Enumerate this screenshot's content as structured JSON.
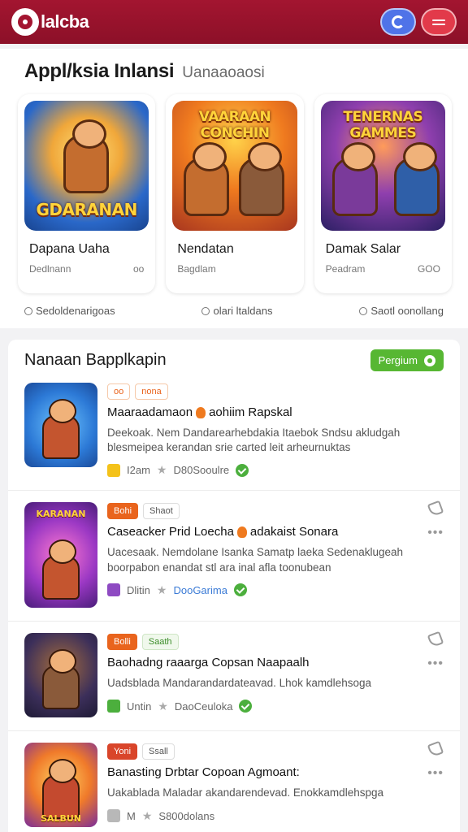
{
  "header": {
    "logo_text": "lalcba",
    "btn_profile": "profile-icon",
    "btn_menu": "menu-icon",
    "colors": {
      "bar": "#a31530",
      "profile": "#4f73e8",
      "menu": "#e23a4a"
    }
  },
  "featured": {
    "title": "Appl/ksia Inlansi",
    "subtitle": "Uanaaoaosi",
    "cards": [
      {
        "name": "Dapana Uaha",
        "meta_left": "Dedlnann",
        "meta_right": "oo",
        "banner": "GDARANAN"
      },
      {
        "name": "Nendatan",
        "meta_left": "Bagdlam",
        "meta_right": "",
        "banner": "VAARAAN CONCHIN"
      },
      {
        "name": "Damak Salar",
        "meta_left": "Peadram",
        "meta_right": "GOO",
        "banner": "TENERNAS GAMMES"
      }
    ]
  },
  "tags": [
    {
      "label": "Sedoldenarigoas"
    },
    {
      "label": "olari ltaldans"
    },
    {
      "label": "Saotl oonollang"
    }
  ],
  "listing": {
    "title": "Nanaan Bapplkapin",
    "action_label": "Pergium",
    "items": [
      {
        "chips": [
          "oo",
          "nona"
        ],
        "title": "Maaraadamaon",
        "title_suffix": "aohiim Rapskal",
        "desc": "Deekoak. Nem Dandarearhebdakia Itaebok Sndsu akludgah blesmeipea kerandan srie carted leit arheurnuktas",
        "meta_a": "I2am",
        "meta_b": "D80Sooulre",
        "banner": ""
      },
      {
        "chips": [
          "Bohi",
          "Shaot"
        ],
        "title": "Caseacker Prid Loecha",
        "title_suffix": "adakaist Sonara",
        "desc": "Uacesaak. Nemdolane Isanka Samatp laeka Sedenaklugeah boorpabon enandat stl ara inal afla toonubean",
        "meta_a": "Dlitin",
        "meta_b": "DooGarima",
        "banner": "KARANAN"
      },
      {
        "chips": [
          "Bolli",
          "Saath"
        ],
        "title": "Baohadng raaarga Copsan Naapaalh",
        "title_suffix": "",
        "desc": "Uadsblada Mandarandardateavad. Lhok kamdlehsoga",
        "meta_a": "Untin",
        "meta_b": "DaoCeuloka",
        "banner": ""
      },
      {
        "chips": [
          "Yoni",
          "Ssall"
        ],
        "title": "Banasting Drbtar Copoan Agmoant:",
        "title_suffix": "",
        "desc": "Uakablada Maladar akandarendevad. Enokkamdlehspga",
        "meta_a": "M",
        "meta_b": "S800dolans",
        "banner": "SALBUN"
      }
    ]
  }
}
